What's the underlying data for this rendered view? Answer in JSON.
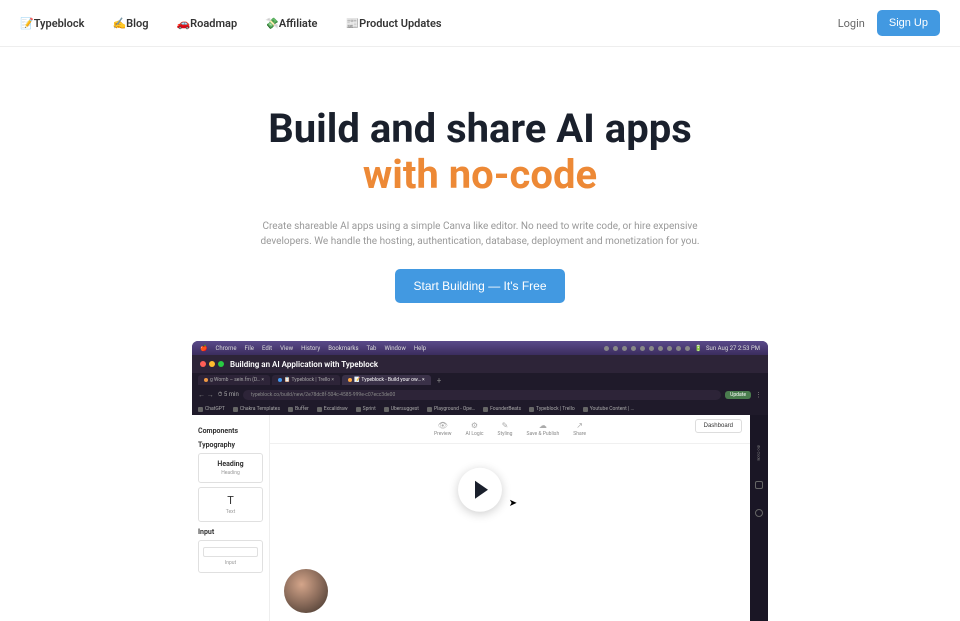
{
  "nav": {
    "logo": "📝Typeblock",
    "items": [
      "✍️Blog",
      "🚗Roadmap",
      "💸Affiliate",
      "📰Product Updates"
    ],
    "login": "Login",
    "signup": "Sign Up"
  },
  "hero": {
    "title": "Build and share AI apps",
    "subtitle": "with no-code",
    "desc": "Create shareable AI apps using a simple Canva like editor. No need to write code, or hire expensive developers. We handle the hosting, authentication, database, deployment and monetization for you.",
    "cta": "Start Building — It's Free"
  },
  "mac": {
    "menus": [
      "Chrome",
      "File",
      "Edit",
      "View",
      "History",
      "Bookmarks",
      "Tab",
      "Window",
      "Help"
    ],
    "time": "Sun Aug 27  2:53 PM"
  },
  "window_title": "Building an AI Application with Typeblock",
  "tabs": [
    "g Womb – sein.fm (D… ×",
    "📋 Typeblock | Trello ×",
    "📝 Typeblock - Build your ow… ×"
  ],
  "url": {
    "timer": "⏱ 5 min",
    "address": "typeblock.co/build/new/2e78dc8f-504c-4585-999e-c07ecc3de00",
    "badge": "Update"
  },
  "bookmarks": [
    "ChatGPT",
    "Chakra Templates",
    "Buffer",
    "Excalidraw",
    "Sprint",
    "Ubersuggest",
    "Playground - Ope…",
    "FounderBeats",
    "Typeblock | Trello",
    "Youtube Content | …"
  ],
  "sidebar": {
    "components": "Components",
    "typography": "Typography",
    "heading": {
      "title": "Heading",
      "sub": "Heading"
    },
    "text": {
      "icon": "T",
      "label": "Text"
    },
    "input_label": "Input",
    "input_sub": "Input"
  },
  "toolbar": {
    "items": [
      {
        "icon": "👁",
        "label": "Preview"
      },
      {
        "icon": "⚙",
        "label": "AI Logic"
      },
      {
        "icon": "✎",
        "label": "Styling"
      },
      {
        "icon": "☁",
        "label": "Save & Publish"
      },
      {
        "icon": "↗",
        "label": "Share"
      }
    ],
    "dashboard": "Dashboard"
  },
  "right_rail": "dio Code"
}
